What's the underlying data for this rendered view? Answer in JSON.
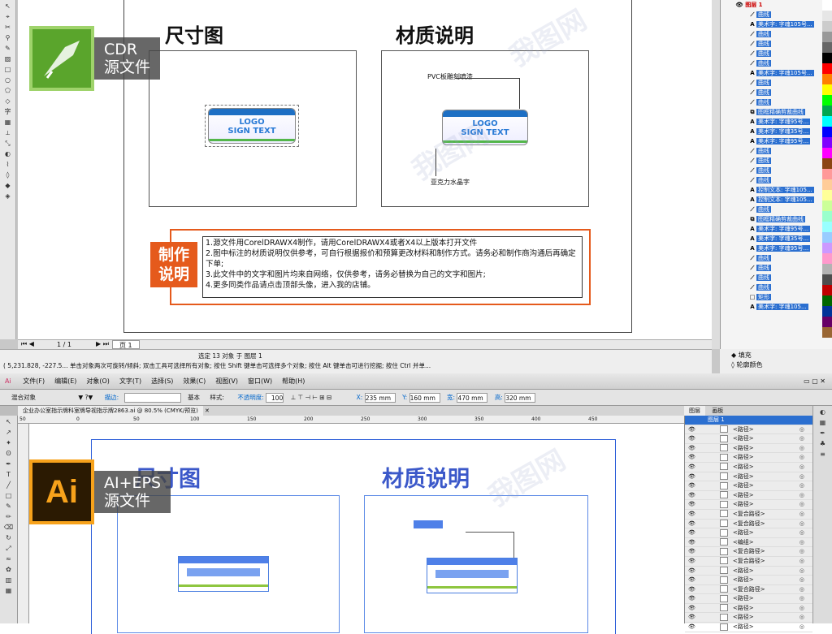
{
  "cdr": {
    "headings": {
      "size": "尺寸图",
      "material": "材质说明"
    },
    "sign": {
      "logo": "LOGO",
      "text": "SIGN TEXT"
    },
    "callouts": {
      "top": "PVC板雕刻喷漆",
      "bottom": "亚克力水晶字"
    },
    "note": {
      "badge": [
        "制作",
        "说明"
      ],
      "lines": [
        "1.源文件用CorelDRAWX4制作，请用CorelDRAWX4或者X4以上版本打开文件",
        "2.图中标注的材质说明仅供参考，可自行根据报价和预算更改材料和制作方式。请务必和制作商沟通后再确定下单;",
        "3.此文件中的文字和图片均来自网络，仅供参考，请务必替换为自己的文字和图片;",
        "4.更多同类作品请点击顶部头像，进入我的店铺。"
      ]
    },
    "page_nav": {
      "counter": "1 / 1",
      "tab": "页 1"
    },
    "status": {
      "selection": "选定 13 对象 于 图层 1",
      "line2": "( 5,231.828, -227.5...  单击对象两次可旋转/倾斜; 双击工具可选择所有对象; 按住 Shift 键单击可选择多个对象; 按住 Alt 键单击可进行挖掘; 按住 Ctrl 并单..."
    },
    "fill": {
      "fill_label": "填充",
      "outline_label": "轮廓颜色"
    },
    "layers": {
      "layer_name": "图层 1",
      "rows": [
        {
          "icon": "curve",
          "label": "曲线"
        },
        {
          "icon": "text",
          "label": "美术字: 字魂105号..."
        },
        {
          "icon": "curve",
          "label": "曲线"
        },
        {
          "icon": "curve",
          "label": "曲线"
        },
        {
          "icon": "curve",
          "label": "曲线"
        },
        {
          "icon": "curve",
          "label": "曲线"
        },
        {
          "icon": "text",
          "label": "美术字: 字魂105号..."
        },
        {
          "icon": "curve",
          "label": "曲线"
        },
        {
          "icon": "curve",
          "label": "曲线"
        },
        {
          "icon": "curve",
          "label": "曲线"
        },
        {
          "icon": "group",
          "label": "图框精确剪裁曲线"
        },
        {
          "icon": "text",
          "label": "美术字: 字魂95号..."
        },
        {
          "icon": "text",
          "label": "美术字: 字魂35号..."
        },
        {
          "icon": "text",
          "label": "美术字: 字魂95号..."
        },
        {
          "icon": "curve",
          "label": "曲线"
        },
        {
          "icon": "curve",
          "label": "曲线"
        },
        {
          "icon": "curve",
          "label": "曲线"
        },
        {
          "icon": "curve",
          "label": "曲线"
        },
        {
          "icon": "text",
          "label": "控制文本: 字魂105..."
        },
        {
          "icon": "text",
          "label": "控制文本: 字魂105..."
        },
        {
          "icon": "curve",
          "label": "曲线"
        },
        {
          "icon": "group",
          "label": "图框精确剪裁曲线"
        },
        {
          "icon": "text",
          "label": "美术字: 字魂95号..."
        },
        {
          "icon": "text",
          "label": "美术字: 字魂35号..."
        },
        {
          "icon": "text",
          "label": "美术字: 字魂95号..."
        },
        {
          "icon": "curve",
          "label": "曲线"
        },
        {
          "icon": "curve",
          "label": "曲线"
        },
        {
          "icon": "curve",
          "label": "曲线"
        },
        {
          "icon": "curve",
          "label": "曲线"
        },
        {
          "icon": "rect",
          "label": "矩形"
        },
        {
          "icon": "text",
          "label": "美术字: 字魂105..."
        }
      ]
    },
    "palette": [
      "#ffffff",
      "#e6e6e6",
      "#cccccc",
      "#999999",
      "#666666",
      "#000000",
      "#ff0000",
      "#ff8000",
      "#ffff00",
      "#00ff00",
      "#00a651",
      "#00ffff",
      "#0000ff",
      "#8000ff",
      "#ff00ff",
      "#8b4513",
      "#ff9999",
      "#ffcc99",
      "#ffff99",
      "#ccff99",
      "#99ffcc",
      "#99ffff",
      "#99ccff",
      "#cc99ff",
      "#ff99cc",
      "#b3b3b3",
      "#4d4d4d",
      "#c00000",
      "#006600",
      "#003399",
      "#660066",
      "#996633"
    ]
  },
  "ai": {
    "menu": [
      "文件(F)",
      "编辑(E)",
      "对象(O)",
      "文字(T)",
      "选择(S)",
      "效果(C)",
      "视图(V)",
      "窗口(W)",
      "帮助(H)"
    ],
    "control": {
      "selection": "混合对象",
      "stroke_label": "描边:",
      "stroke_style": "基本",
      "style_label": "样式:",
      "opacity_label": "不透明度:",
      "opacity": "100",
      "x_label": "X:",
      "x": "235 mm",
      "y_label": "Y:",
      "y": "160 mm",
      "w_label": "宽:",
      "w": "470 mm",
      "h_label": "高:",
      "h": "320 mm"
    },
    "doc_tab": "企业办公室指示牌科室牌导视指示牌2863.ai @ 80.5% (CMYK/预览)",
    "ruler_ticks": [
      "50",
      "0",
      "50",
      "100",
      "150",
      "200",
      "250",
      "300",
      "350",
      "400",
      "450"
    ],
    "headings": {
      "size": "尺寸图",
      "material": "材质说明"
    },
    "layers_tabs": [
      "图层",
      "画板"
    ],
    "layer_name": "图层 1",
    "rows": [
      "<路径>",
      "<路径>",
      "<路径>",
      "<路径>",
      "<路径>",
      "<路径>",
      "<路径>",
      "<路径>",
      "<路径>",
      "<复合路径>",
      "<复合路径>",
      "<路径>",
      "<编组>",
      "<复合路径>",
      "<复合路径>",
      "<路径>",
      "<路径>",
      "<复合路径>",
      "<路径>",
      "<路径>",
      "<路径>",
      "<路径>"
    ]
  },
  "badges": {
    "cdr": {
      "line1": "CDR",
      "line2": "源文件"
    },
    "ai": {
      "logo": "Ai",
      "line1": "AI+EPS",
      "line2": "源文件"
    }
  }
}
